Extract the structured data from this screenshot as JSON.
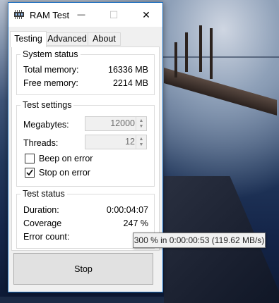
{
  "window": {
    "title": "RAM Test",
    "minimize_glyph": "—",
    "maximize_glyph": "☐",
    "close_glyph": "✕"
  },
  "tabs": [
    {
      "label": "Testing",
      "active": true
    },
    {
      "label": "Advanced",
      "active": false
    },
    {
      "label": "About",
      "active": false
    }
  ],
  "system_status": {
    "legend": "System status",
    "total_label": "Total memory:",
    "total_value": "16336 MB",
    "free_label": "Free memory:",
    "free_value": "2214 MB"
  },
  "test_settings": {
    "legend": "Test settings",
    "megabytes_label": "Megabytes:",
    "megabytes_value": "12000",
    "threads_label": "Threads:",
    "threads_value": "12",
    "beep_label": "Beep on error",
    "beep_checked": false,
    "stop_label": "Stop on error",
    "stop_checked": true
  },
  "test_status": {
    "legend": "Test status",
    "duration_label": "Duration:",
    "duration_value": "0:00:04:07",
    "coverage_label": "Coverage",
    "coverage_value": "247 %",
    "error_label": "Error count:",
    "error_value": ""
  },
  "stop_button": "Stop",
  "tooltip": "300 % in 0:00:00:53 (119.62 MB/s)",
  "icons": {
    "app": "ram-chip-icon",
    "check": "checkmark-icon"
  },
  "colors": {
    "window_border": "#1e6fbf",
    "button_face": "#e1e1e1"
  }
}
